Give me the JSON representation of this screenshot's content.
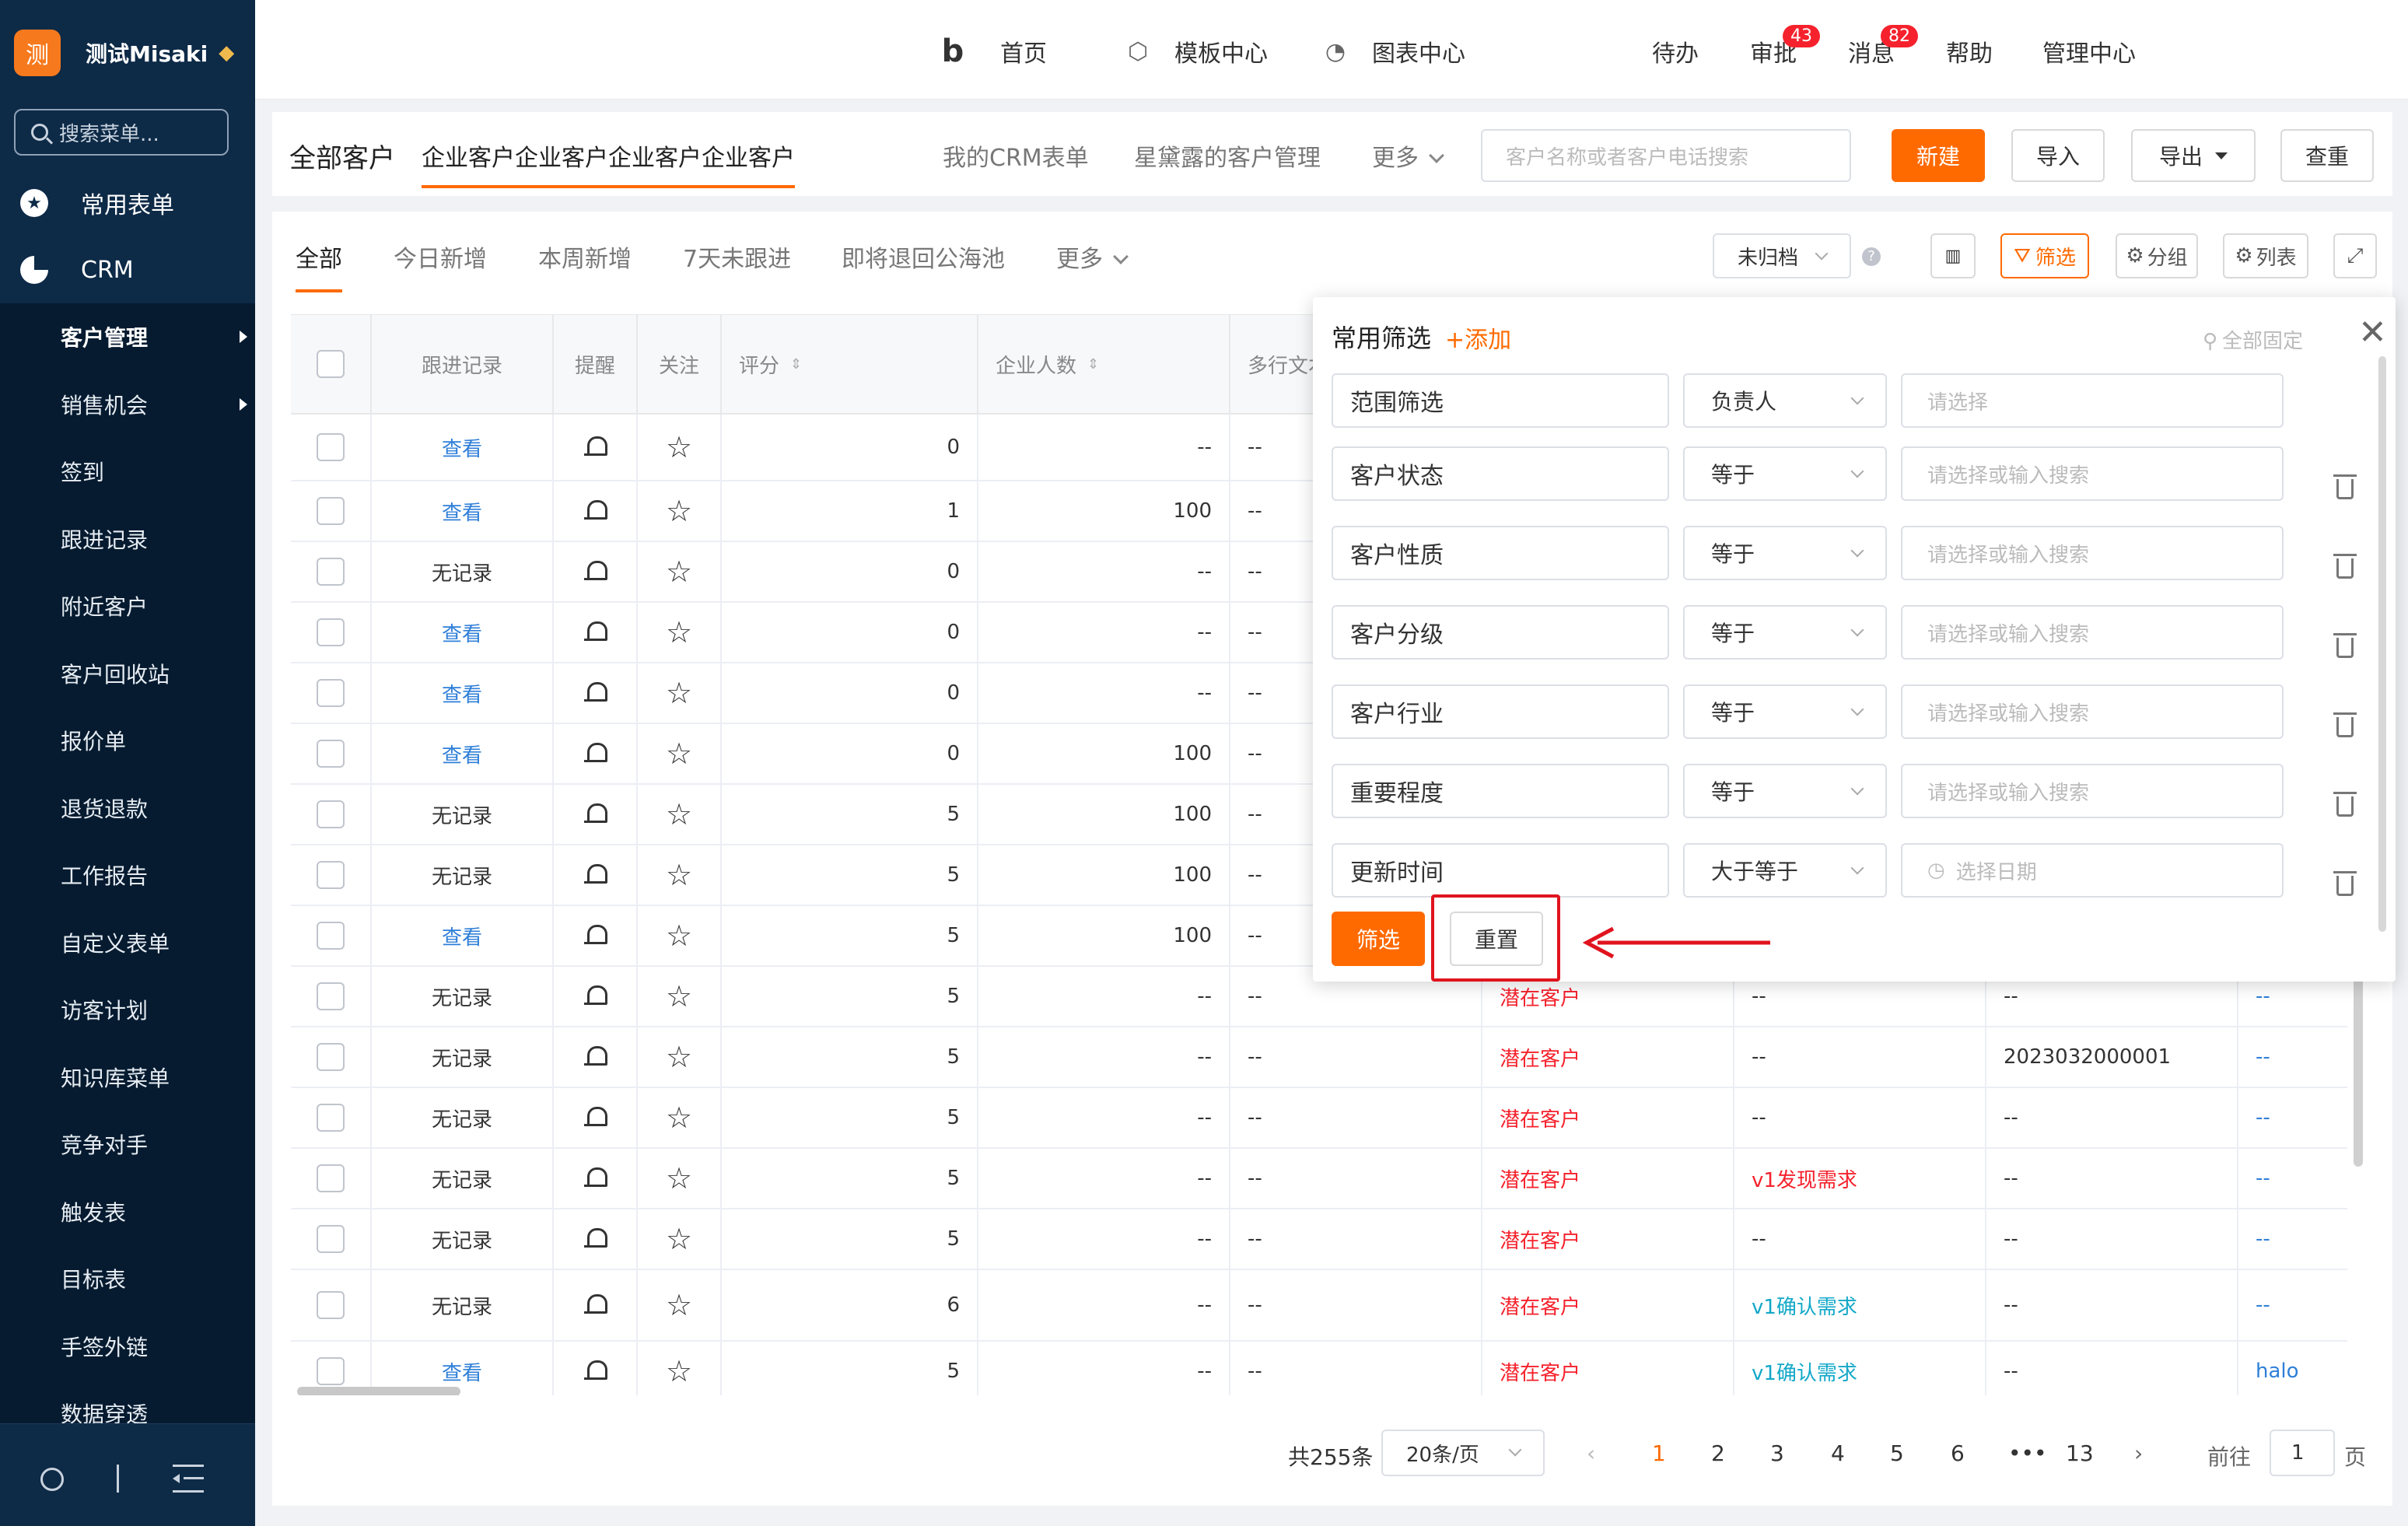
{
  "sidebar": {
    "logo_char": "测",
    "app_name": "测试Misaki",
    "search_placeholder": "搜索菜单...",
    "top_items": [
      {
        "label": "常用表单",
        "icon": "star-icon"
      },
      {
        "label": "CRM",
        "icon": "pie-icon"
      }
    ],
    "sub_items": [
      {
        "label": "客户管理",
        "active": true,
        "arrow": true
      },
      {
        "label": "销售机会",
        "active": false,
        "arrow": true
      },
      {
        "label": "签到"
      },
      {
        "label": "跟进记录"
      },
      {
        "label": "附近客户"
      },
      {
        "label": "客户回收站"
      },
      {
        "label": "报价单"
      },
      {
        "label": "退货退款"
      },
      {
        "label": "工作报告"
      },
      {
        "label": "自定义表单"
      },
      {
        "label": "访客计划"
      },
      {
        "label": "知识库菜单"
      },
      {
        "label": "竞争对手"
      },
      {
        "label": "触发表"
      },
      {
        "label": "目标表"
      },
      {
        "label": "手签外链"
      },
      {
        "label": "数据穿透"
      }
    ]
  },
  "topnav": {
    "home": "首页",
    "templates": "模板中心",
    "charts": "图表中心",
    "todo": "待办",
    "approve": "审批",
    "approve_badge": "43",
    "messages": "消息",
    "messages_badge": "82",
    "help": "帮助",
    "admin": "管理中心"
  },
  "header": {
    "title": "全部客户",
    "tabs": [
      "企业客户企业客户企业客户企业客户",
      "我的CRM表单",
      "星黛露的客户管理"
    ],
    "more": "更多",
    "search_placeholder": "客户名称或者客户电话搜索",
    "new_btn": "新建",
    "import_btn": "导入",
    "export_btn": "导出",
    "dedupe_btn": "查重"
  },
  "subtabs": {
    "tabs": [
      "全部",
      "今日新增",
      "本周新增",
      "7天未跟进",
      "即将退回公海池"
    ],
    "more": "更多",
    "archive_select": "未归档",
    "filter_btn": "筛选",
    "group_btn": "分组",
    "list_btn": "列表"
  },
  "table": {
    "columns": [
      "跟进记录",
      "提醒",
      "关注",
      "评分",
      "企业人数",
      "多行文本"
    ],
    "rows": [
      {
        "follow": "查看",
        "score": "0",
        "people": "--",
        "text": "--"
      },
      {
        "follow": "查看",
        "score": "1",
        "people": "100",
        "text": "--"
      },
      {
        "follow": "无记录",
        "score": "0",
        "people": "--",
        "text": "--"
      },
      {
        "follow": "查看",
        "score": "0",
        "people": "--",
        "text": "--"
      },
      {
        "follow": "查看",
        "score": "0",
        "people": "--",
        "text": "--"
      },
      {
        "follow": "查看",
        "score": "0",
        "people": "100",
        "text": "--"
      },
      {
        "follow": "无记录",
        "score": "5",
        "people": "100",
        "text": "--"
      },
      {
        "follow": "无记录",
        "score": "5",
        "people": "100",
        "text": "--"
      },
      {
        "follow": "查看",
        "score": "5",
        "people": "100",
        "text": "--"
      },
      {
        "follow": "无记录",
        "score": "5",
        "people": "--",
        "text": "--",
        "status": "潜在客户",
        "stage": "--",
        "code": "--",
        "extra": "--"
      },
      {
        "follow": "无记录",
        "score": "5",
        "people": "--",
        "text": "--",
        "status": "潜在客户",
        "stage": "--",
        "code": "2023032000001",
        "extra": "--"
      },
      {
        "follow": "无记录",
        "score": "5",
        "people": "--",
        "text": "--",
        "status": "潜在客户",
        "stage": "--",
        "code": "--",
        "extra": "--"
      },
      {
        "follow": "无记录",
        "score": "5",
        "people": "--",
        "text": "--",
        "status": "潜在客户",
        "stage": "v1发现需求",
        "stage_color": "red",
        "code": "--",
        "extra": "--"
      },
      {
        "follow": "无记录",
        "score": "5",
        "people": "--",
        "text": "--",
        "status": "潜在客户",
        "stage": "--",
        "code": "--",
        "extra": "--"
      },
      {
        "follow": "无记录",
        "score": "6",
        "people": "--",
        "text": "--",
        "status": "潜在客户",
        "stage": "v1确认需求",
        "stage_color": "cyan",
        "code": "--",
        "extra": "--"
      },
      {
        "follow": "查看",
        "score": "5",
        "people": "--",
        "text": "--",
        "status": "潜在客户",
        "stage": "v1确认需求",
        "stage_color": "cyan",
        "code": "--",
        "extra": "halo"
      }
    ]
  },
  "filter_panel": {
    "title": "常用筛选",
    "add": "+添加",
    "pin_all": "全部固定",
    "rows": [
      {
        "field": "范围筛选",
        "op": "负责人",
        "value_placeholder": "请选择",
        "deletable": false
      },
      {
        "field": "客户状态",
        "op": "等于",
        "value_placeholder": "请选择或输入搜索",
        "deletable": true
      },
      {
        "field": "客户性质",
        "op": "等于",
        "value_placeholder": "请选择或输入搜索",
        "deletable": true
      },
      {
        "field": "客户分级",
        "op": "等于",
        "value_placeholder": "请选择或输入搜索",
        "deletable": true
      },
      {
        "field": "客户行业",
        "op": "等于",
        "value_placeholder": "请选择或输入搜索",
        "deletable": true
      },
      {
        "field": "重要程度",
        "op": "等于",
        "value_placeholder": "请选择或输入搜索",
        "deletable": true
      },
      {
        "field": "更新时间",
        "op": "大于等于",
        "value_placeholder": "选择日期",
        "deletable": true
      }
    ],
    "apply_btn": "筛选",
    "reset_btn": "重置",
    "highlight_color": "#e0141e"
  },
  "pagination": {
    "total": "共255条",
    "page_size": "20条/页",
    "pages": [
      "1",
      "2",
      "3",
      "4",
      "5",
      "6",
      "•••",
      "13"
    ],
    "current": "1",
    "goto_label": "前往",
    "goto_value": "1",
    "page_suffix": "页"
  },
  "colors": {
    "accent": "#ff6a00",
    "sidebar": "#0d2a47",
    "link": "#2f7fd8",
    "danger": "#f5222d"
  }
}
